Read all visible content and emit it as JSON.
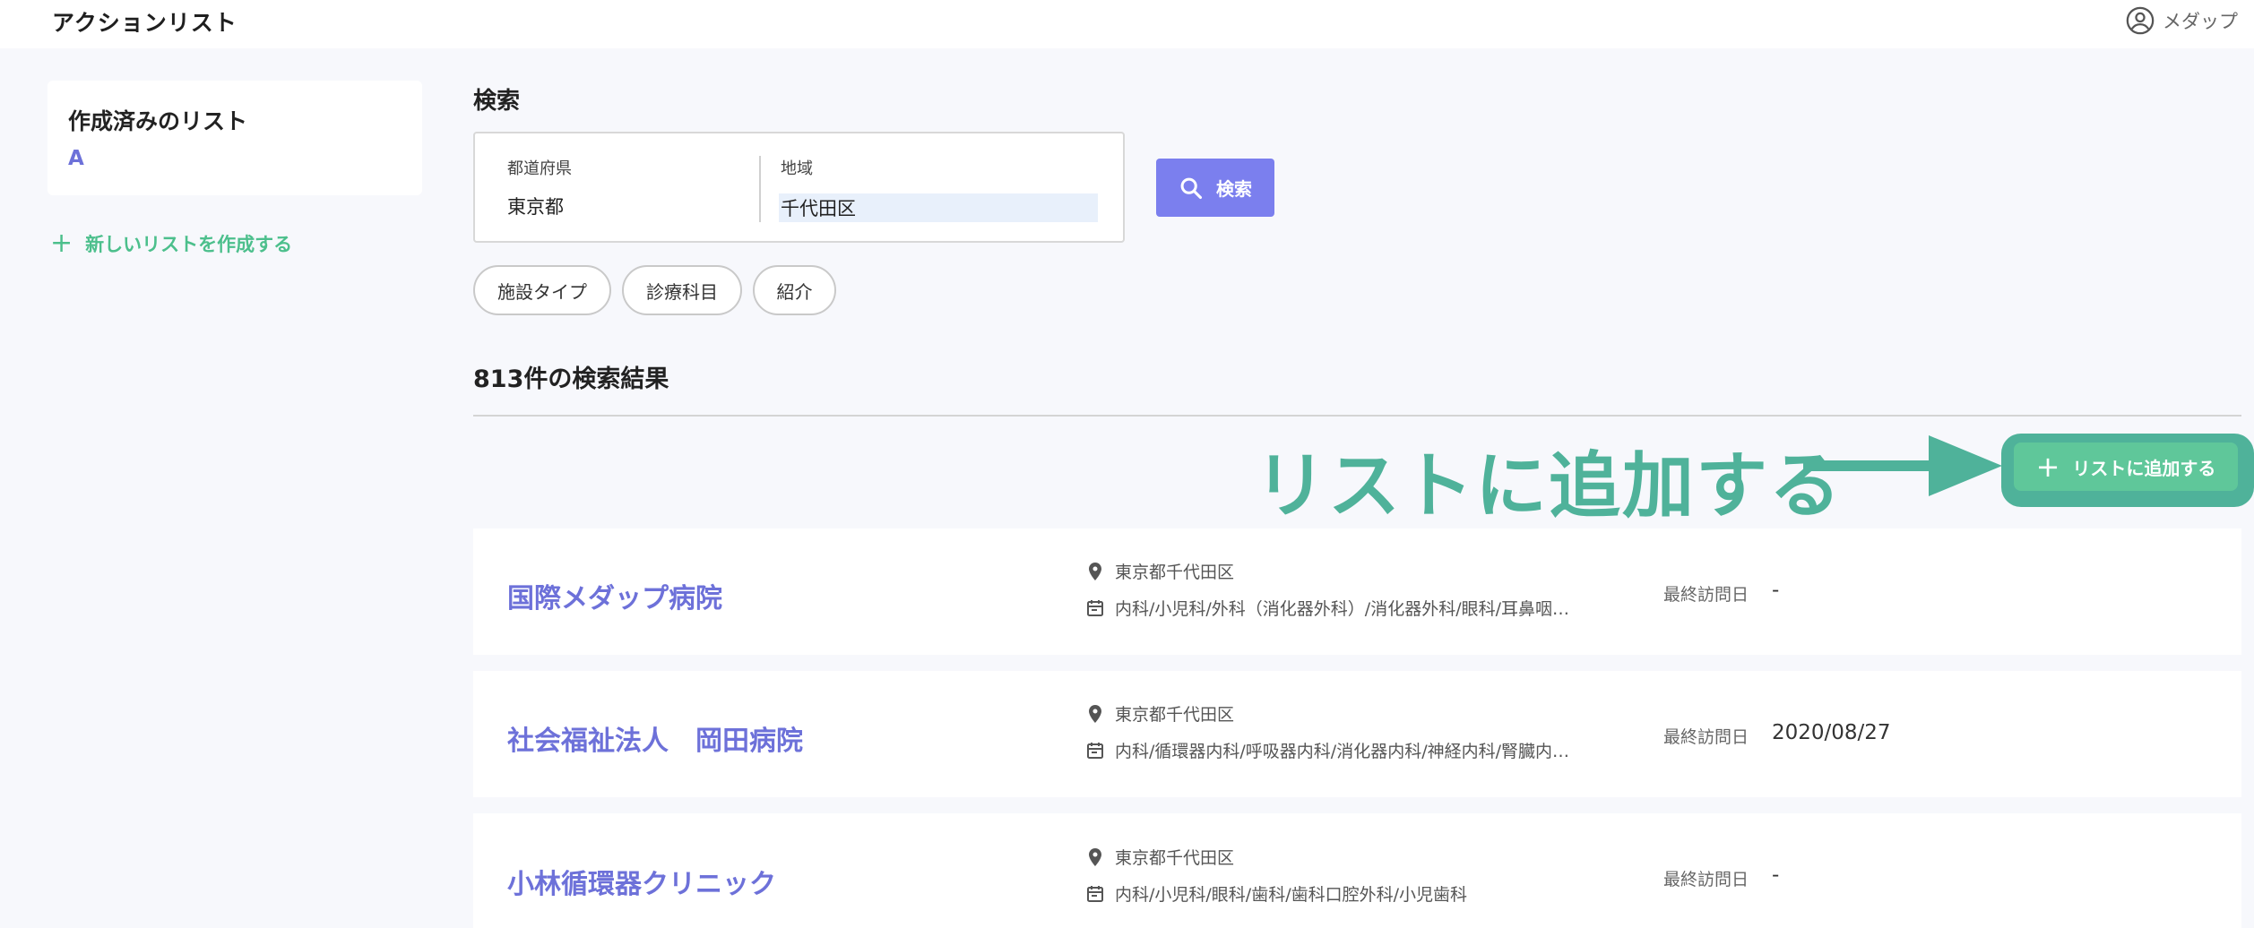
{
  "app": {
    "title": "アクションリスト",
    "user_name": "メダップ"
  },
  "sidebar": {
    "saved_lists_title": "作成済みのリスト",
    "lists": [
      "A"
    ],
    "new_list_label": "新しいリストを作成する"
  },
  "search": {
    "heading": "検索",
    "prefecture_label": "都道府県",
    "prefecture_value": "東京都",
    "region_label": "地域",
    "region_value": "千代田区",
    "button_label": "検索",
    "filters": [
      "施設タイプ",
      "診療科目",
      "紹介"
    ]
  },
  "results": {
    "count_text": "813件の検索結果",
    "add_to_list_label": "リストに追加する",
    "last_visit_label": "最終訪問日",
    "items": [
      {
        "name": "国際メダップ病院",
        "address": "東京都千代田区",
        "departments": "内科/小児科/外科（消化器外科）/消化器外科/眼科/耳鼻咽…",
        "last_visit": "-"
      },
      {
        "name": "社会福祉法人　岡田病院",
        "address": "東京都千代田区",
        "departments": "内科/循環器内科/呼吸器内科/消化器内科/神経内科/腎臓内…",
        "last_visit": "2020/08/27"
      },
      {
        "name": "小林循環器クリニック",
        "address": "東京都千代田区",
        "departments": "内科/小児科/眼科/歯科/歯科口腔外科/小児歯科",
        "last_visit": "-"
      }
    ]
  },
  "annotation": {
    "text": "リストに追加する",
    "color": "#4fb29a"
  },
  "colors": {
    "accent": "#7b7fee",
    "link": "#6d71d9",
    "green": "#5fc79a"
  }
}
